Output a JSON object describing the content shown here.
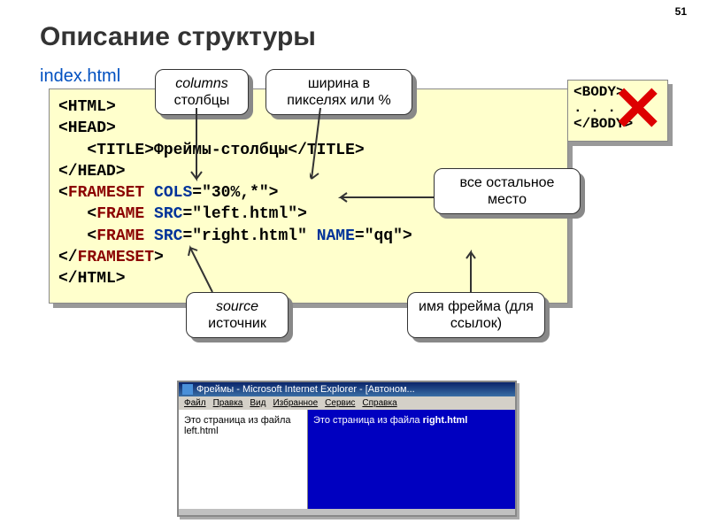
{
  "page_number": "51",
  "title": "Описание структуры",
  "filename": "index.html",
  "code": {
    "l1": "<HTML>",
    "l2": "<HEAD>",
    "l3_open": "   <TITLE>",
    "l3_text": "Фреймы-столбцы",
    "l3_close": "</TITLE>",
    "l4": "</HEAD>",
    "l5_open": "<",
    "l5_tag": "FRAMESET",
    "l5_sp": " ",
    "l5_attr": "COLS",
    "l5_rest": "=\"30%,*\">",
    "l6_open": "   <",
    "l6_tag": "FRAME",
    "l6_sp": " ",
    "l6_attr": "SRC",
    "l6_rest": "=\"left.html\">",
    "l7_open": "   <",
    "l7_tag": "FRAME",
    "l7_sp": " ",
    "l7_attr1": "SRC",
    "l7_mid": "=\"right.html\" ",
    "l7_attr2": "NAME",
    "l7_rest": "=\"qq\">",
    "l8_open": "</",
    "l8_tag": "FRAMESET",
    "l8_close": ">",
    "l9": "</HTML>"
  },
  "callouts": {
    "columns_it": "columns",
    "columns_ru": "столбцы",
    "width": "ширина в пикселях или %",
    "rest": "все остальное место",
    "source_it": "source",
    "source_ru": "источник",
    "framename": "имя фрейма (для ссылок)"
  },
  "bodybox": {
    "open": "<BODY>",
    "dots": ". . .",
    "close": "</BODY>"
  },
  "ie": {
    "title": "Фреймы - Microsoft Internet Explorer - [Автоном...",
    "menu": {
      "file": "Файл",
      "edit": "Правка",
      "view": "Вид",
      "fav": "Избранное",
      "tools": "Сервис",
      "help": "Справка"
    },
    "left": "Это страница из файла left.html",
    "right_text": "Это страница из файла ",
    "right_bold": "right.html"
  }
}
